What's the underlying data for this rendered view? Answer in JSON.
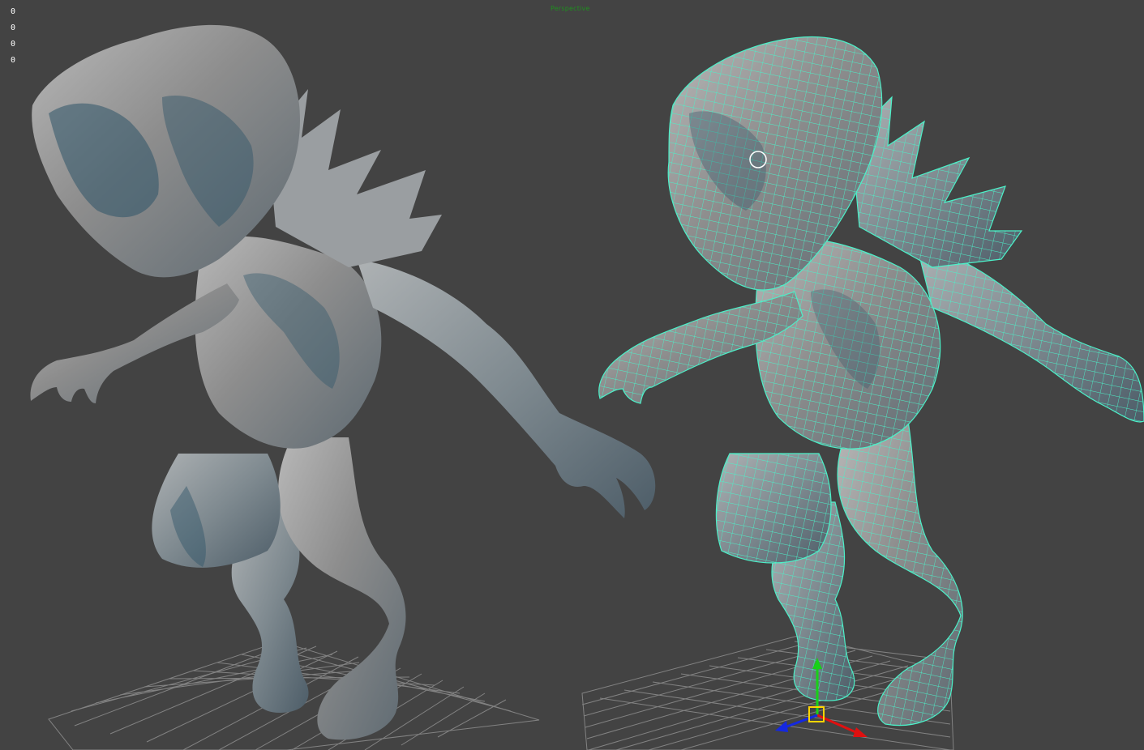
{
  "viewport": {
    "label": "Perspective",
    "stats": [
      "0",
      "0",
      "0",
      "0"
    ]
  },
  "models": {
    "left_model": "sculpted-high-poly",
    "right_model": "retopology-wireframe-overlay"
  },
  "colors": {
    "background": "#434343",
    "grid": "#8c8c8c",
    "model_surface": "#a9a9a9",
    "model_shadow": "#23485c",
    "wire": "#4cf0c8",
    "axis_x": "#e01010",
    "axis_y": "#18d018",
    "axis_z": "#1428e0",
    "gizmo_box": "#ffd400",
    "label_green": "#1f8f1f"
  }
}
